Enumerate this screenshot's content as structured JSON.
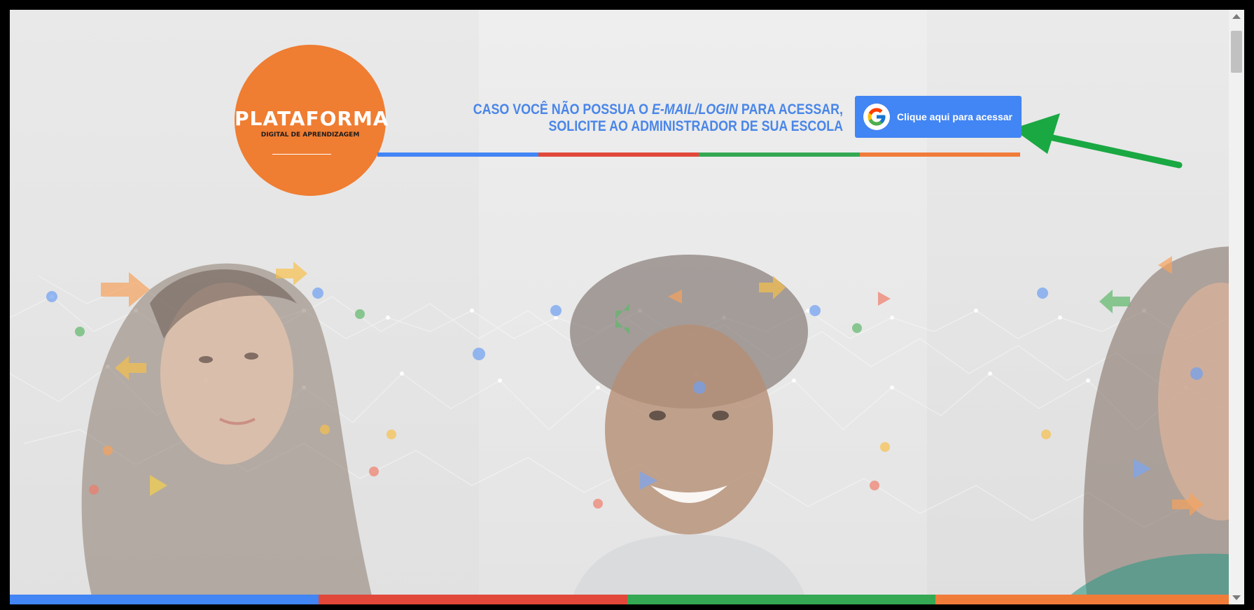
{
  "logo": {
    "title": "PLATAFORMA",
    "subtitle": "DIGITAL DE APRENDIZAGEM"
  },
  "notice": {
    "line1_prefix": "CASO VOCÊ NÃO POSSUA O ",
    "line1_emphasis": "E-MAIL/LOGIN",
    "line1_suffix": " PARA ACESSAR,",
    "line2": "SOLICITE AO ADMINISTRADOR DE SUA ESCOLA"
  },
  "login_button": {
    "label": "Clique aqui para acessar",
    "icon": "google-icon"
  },
  "colors": {
    "blue": "#4285f4",
    "red": "#e1483a",
    "green": "#34a853",
    "orange": "#f07c3a",
    "logo": "#ef7d32",
    "notice_text": "#4a86e8",
    "annotation_arrow": "#1aa843"
  }
}
